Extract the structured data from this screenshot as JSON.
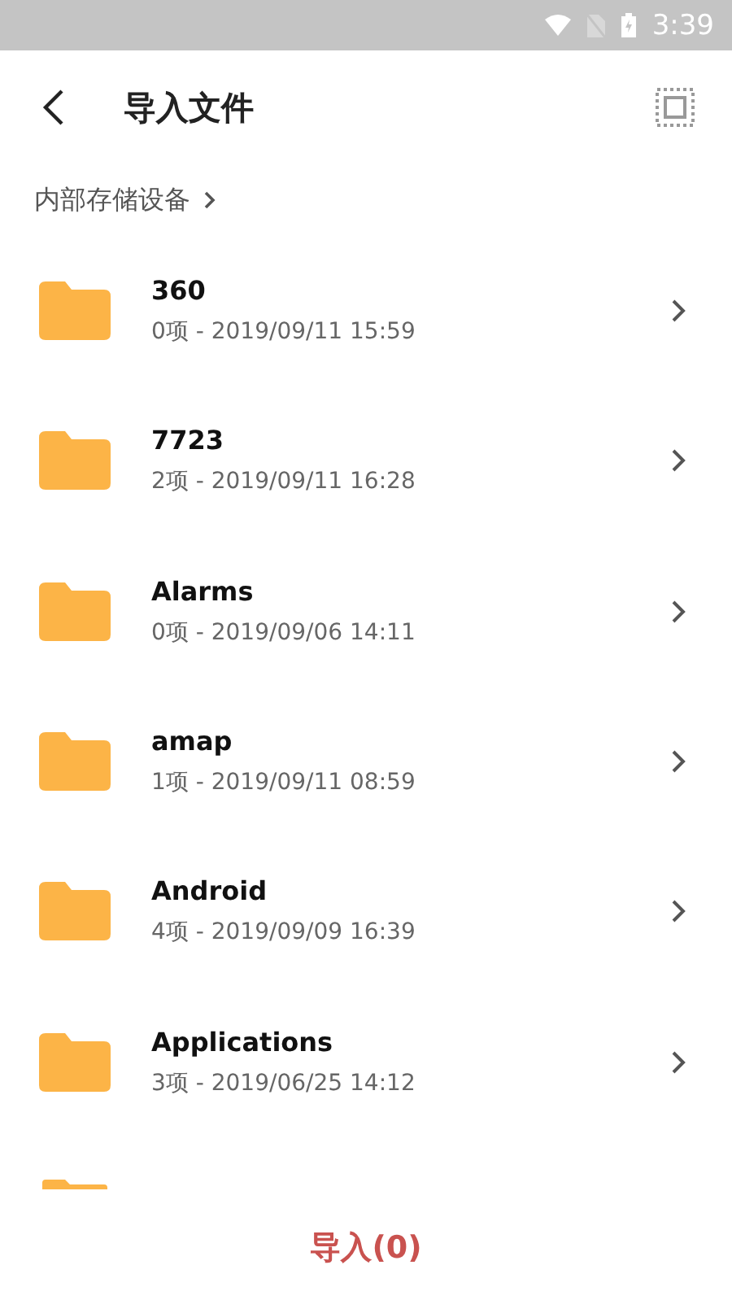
{
  "status_bar": {
    "time": "3:39"
  },
  "header": {
    "title": "导入文件"
  },
  "breadcrumb": {
    "path": "内部存储设备"
  },
  "folders": [
    {
      "name": "360",
      "info": "0项  -  2019/09/11 15:59"
    },
    {
      "name": "7723",
      "info": "2项  -  2019/09/11 16:28"
    },
    {
      "name": "Alarms",
      "info": "0项  -  2019/09/06 14:11"
    },
    {
      "name": "amap",
      "info": "1项  -  2019/09/11 08:59"
    },
    {
      "name": "Android",
      "info": "4项  -  2019/09/09 16:39"
    },
    {
      "name": "Applications",
      "info": "3项  -  2019/06/25 14:12"
    }
  ],
  "import_button": {
    "label": "导入(0)"
  }
}
